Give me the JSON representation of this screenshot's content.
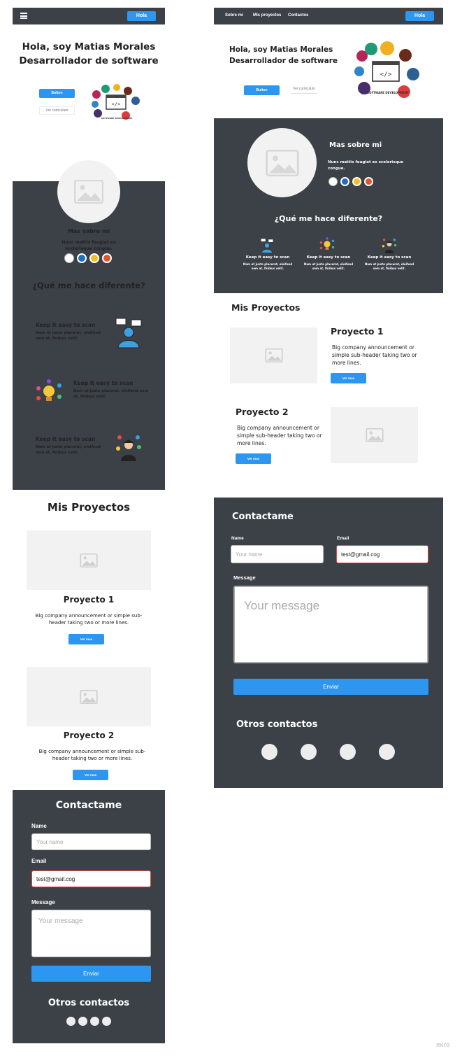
{
  "mobile": {
    "nav": {
      "cta": "Hola"
    },
    "hero": {
      "line1": "Hola, soy Matias Morales",
      "line2": "Desarrollador de software",
      "primary_btn": "Button",
      "secondary_link": "Ver curriculum"
    },
    "about": {
      "title": "Mas sobre mi",
      "text": "Nunc mattis feugiat ex scelerisque congue.",
      "diff_title": "¿Qué me hace diferente?"
    },
    "features": [
      {
        "title": "Keep it easy to scan",
        "text": "Nam ut justo placerat, eleifend sem at, finibus velit."
      },
      {
        "title": "Keep it easy to scan",
        "text": "Nam ut justo placerat, eleifend sem at, finibus velit."
      },
      {
        "title": "Keep it easy to scan",
        "text": "Nam ut justo placerat, eleifend sem at, finibus velit."
      }
    ],
    "projects": {
      "title": "Mis Proyectos",
      "items": [
        {
          "name": "Proyecto 1",
          "desc": "Big company announcement or simple sub-header taking two or more lines.",
          "btn": "Ver mas"
        },
        {
          "name": "Proyecto 2",
          "desc": "Big company announcement or simple sub-header taking two or more lines.",
          "btn": "Ver mas"
        }
      ]
    },
    "contact": {
      "title": "Contactame",
      "name_label": "Name",
      "name_placeholder": "Your name",
      "email_label": "Email",
      "email_value": "test@gmail.cog",
      "message_label": "Message",
      "message_placeholder": "Your message",
      "submit": "Enviar",
      "others_title": "Otros contactos"
    }
  },
  "desktop": {
    "nav": {
      "links": [
        "Sobre mi",
        "Mis proyectos",
        "Contactos"
      ],
      "cta": "Hola"
    },
    "hero": {
      "line1": "Hola, soy Matias Morales",
      "line2": "Desarrollador de software",
      "primary_btn": "Button",
      "secondary_link": "Ver curriculum"
    },
    "about": {
      "title": "Mas sobre mi",
      "text": "Nunc mattis feugiat ex scelerisque congue.",
      "diff_title": "¿Qué me hace diferente?"
    },
    "features": [
      {
        "title": "Keep it easy to scan",
        "text": "Nam ut justo placerat, eleifend sem at, finibus velit."
      },
      {
        "title": "Keep it easy to scan",
        "text": "Nam ut justo placerat, eleifend sem at, finibus velit."
      },
      {
        "title": "Keep it easy to scan",
        "text": "Nam ut justo placerat, eleifend sem at, finibus velit."
      }
    ],
    "projects": {
      "title": "Mis Proyectos",
      "items": [
        {
          "name": "Proyecto 1",
          "desc": "Big company announcement or simple sub-header taking two or more lines.",
          "btn": "Ver mas"
        },
        {
          "name": "Proyecto 2",
          "desc": "Big company announcement or simple sub-header taking two or more lines.",
          "btn": "Ver mas"
        }
      ]
    },
    "contact": {
      "title": "Contactame",
      "name_label": "Name",
      "name_placeholder": "Your name",
      "email_label": "Email",
      "email_value": "test@gmail.cog",
      "message_label": "Message",
      "message_placeholder": "Your message",
      "submit": "Enviar",
      "others_title": "Otros contactos"
    }
  },
  "software_graphic_text": "SOFTWARE DEVELOPMENT",
  "watermark": "miro",
  "colors": {
    "dark": "#3c4148",
    "accent": "#2d96f0",
    "error": "#e54b3c"
  }
}
